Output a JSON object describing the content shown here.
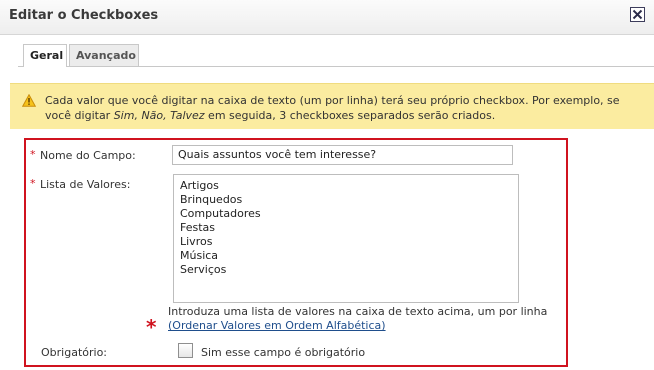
{
  "dialog": {
    "title": "Editar o Checkboxes",
    "close_icon": "close-icon"
  },
  "tabs": [
    {
      "label": "Geral",
      "active": true
    },
    {
      "label": "Avançado",
      "active": false
    }
  ],
  "notice": {
    "icon": "warning-icon",
    "text_part1": "Cada valor que você digitar na caixa de texto (um por linha) terá seu próprio checkbox. Por exemplo, se você digitar ",
    "text_example": "Sim, Não, Talvez",
    "text_part2": " em seguida, 3 checkboxes separados serão criados."
  },
  "form": {
    "field_name": {
      "required_mark": "*",
      "label": "Nome do Campo:",
      "value": "Quais assuntos você tem interesse?"
    },
    "values": {
      "required_mark": "*",
      "label": "Lista de Valores:",
      "items": [
        "Artigos",
        "Brinquedos",
        "Computadores",
        "Festas",
        "Livros",
        "Música",
        "Serviços"
      ],
      "hint": "Introduza uma lista de valores na caixa de texto acima, um por linha",
      "big_required_mark": "*",
      "sort_link": "(Ordenar Valores em Ordem Alfabética)"
    },
    "required": {
      "label": "Obrigatório:",
      "checkbox_label": "Sim esse campo é obrigatório",
      "checked": false
    }
  },
  "colors": {
    "highlight_border": "#d0131f",
    "notice_bg": "#fbeca0",
    "link": "#1f4e8c"
  }
}
